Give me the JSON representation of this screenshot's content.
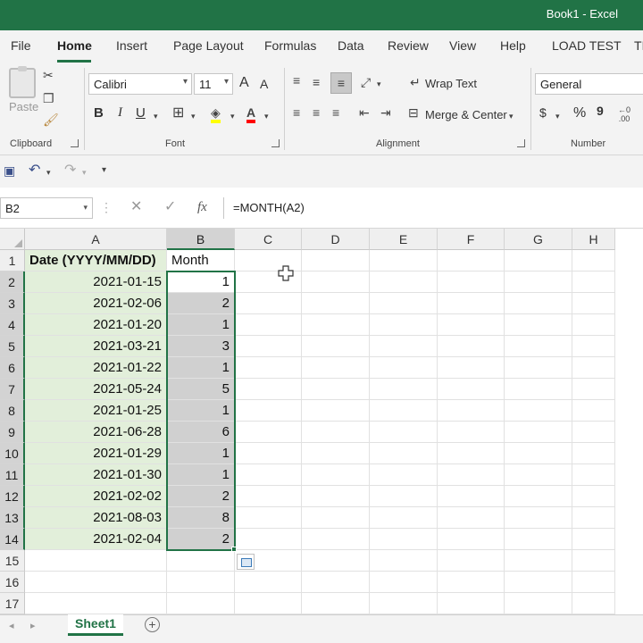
{
  "window": {
    "title": "Book1  -  Excel"
  },
  "ribbon_tabs": [
    "File",
    "Home",
    "Insert",
    "Page Layout",
    "Formulas",
    "Data",
    "Review",
    "View",
    "Help",
    "LOAD TEST",
    "TI"
  ],
  "ribbon": {
    "clipboard": {
      "label": "Clipboard",
      "paste": "Paste"
    },
    "font": {
      "label": "Font",
      "name": "Calibri",
      "size": "11",
      "bold": "B",
      "italic": "I",
      "underline": "U",
      "grow": "A",
      "shrink": "A"
    },
    "alignment": {
      "label": "Alignment",
      "wrap_text": "Wrap Text",
      "merge_center": "Merge & Center"
    },
    "number": {
      "label": "Number",
      "format": "General",
      "currency": "$",
      "percent": "%",
      "comma": "9"
    }
  },
  "formula_bar": {
    "name_box": "B2",
    "fx": "fx",
    "formula": "=MONTH(A2)"
  },
  "sheet": {
    "columns": [
      "A",
      "B",
      "C",
      "D",
      "E",
      "F",
      "G",
      "H"
    ],
    "rows": [
      "1",
      "2",
      "3",
      "4",
      "5",
      "6",
      "7",
      "8",
      "9",
      "10",
      "11",
      "12",
      "13",
      "14",
      "15",
      "16",
      "17"
    ],
    "header_a": "Date (YYYY/MM/DD)",
    "header_b": "Month",
    "data": [
      {
        "date": "2021-01-15",
        "month": "1"
      },
      {
        "date": "2021-02-06",
        "month": "2"
      },
      {
        "date": "2021-01-20",
        "month": "1"
      },
      {
        "date": "2021-03-21",
        "month": "3"
      },
      {
        "date": "2021-01-22",
        "month": "1"
      },
      {
        "date": "2021-05-24",
        "month": "5"
      },
      {
        "date": "2021-01-25",
        "month": "1"
      },
      {
        "date": "2021-06-28",
        "month": "6"
      },
      {
        "date": "2021-01-29",
        "month": "1"
      },
      {
        "date": "2021-01-30",
        "month": "1"
      },
      {
        "date": "2021-02-02",
        "month": "2"
      },
      {
        "date": "2021-08-03",
        "month": "8"
      },
      {
        "date": "2021-02-04",
        "month": "2"
      }
    ]
  },
  "sheet_tabs": {
    "active": "Sheet1",
    "add": "+"
  },
  "colors": {
    "accent": "#217346",
    "selection_fill": "#e2efda",
    "selected_gray": "#d0d0d0"
  },
  "icons": [
    "cut-icon",
    "copy-icon",
    "format-painter-icon",
    "borders-icon",
    "fill-color-icon",
    "font-color-icon",
    "save-icon",
    "undo-icon",
    "redo-icon",
    "cancel-icon",
    "enter-icon",
    "function-icon",
    "quick-analysis-icon",
    "add-sheet-icon"
  ]
}
